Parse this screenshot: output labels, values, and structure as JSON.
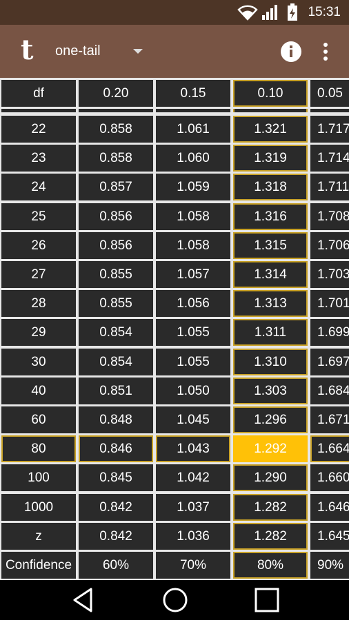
{
  "status_bar": {
    "time": "15:31",
    "icons": [
      "wifi-icon",
      "signal-icon",
      "battery-charging-icon"
    ]
  },
  "app_bar": {
    "logo": "t",
    "mode": "one-tail",
    "mode_dropdown_icon": "dropdown-arrow-icon",
    "info_icon": "info-icon",
    "more_icon": "more-vert-icon"
  },
  "table": {
    "header": [
      "df",
      "0.20",
      "0.15",
      "0.10",
      "0.05"
    ],
    "rows": [
      [
        "22",
        "0.858",
        "1.061",
        "1.321",
        "1.717"
      ],
      [
        "23",
        "0.858",
        "1.060",
        "1.319",
        "1.714"
      ],
      [
        "24",
        "0.857",
        "1.059",
        "1.318",
        "1.711"
      ],
      [
        "25",
        "0.856",
        "1.058",
        "1.316",
        "1.708"
      ],
      [
        "26",
        "0.856",
        "1.058",
        "1.315",
        "1.706"
      ],
      [
        "27",
        "0.855",
        "1.057",
        "1.314",
        "1.703"
      ],
      [
        "28",
        "0.855",
        "1.056",
        "1.313",
        "1.701"
      ],
      [
        "29",
        "0.854",
        "1.055",
        "1.311",
        "1.699"
      ],
      [
        "30",
        "0.854",
        "1.055",
        "1.310",
        "1.697"
      ],
      [
        "40",
        "0.851",
        "1.050",
        "1.303",
        "1.684"
      ],
      [
        "60",
        "0.848",
        "1.045",
        "1.296",
        "1.671"
      ],
      [
        "80",
        "0.846",
        "1.043",
        "1.292",
        "1.664"
      ],
      [
        "100",
        "0.845",
        "1.042",
        "1.290",
        "1.660"
      ],
      [
        "1000",
        "0.842",
        "1.037",
        "1.282",
        "1.646"
      ],
      [
        "z",
        "0.842",
        "1.036",
        "1.282",
        "1.645"
      ]
    ],
    "footer": [
      "Confidence",
      "60%",
      "70%",
      "80%",
      "90%"
    ],
    "highlight_col": 3,
    "highlight_row": 11
  },
  "nav_bar": {
    "icons": [
      "back-icon",
      "home-icon",
      "recents-icon"
    ]
  },
  "colors": {
    "status_bar": "#4d3526",
    "app_bar": "#785444",
    "cell": "#2a2a2a",
    "grid": "#e7e7e7",
    "highlight_border": "#c9a227",
    "selected_cell": "#ffc107"
  }
}
